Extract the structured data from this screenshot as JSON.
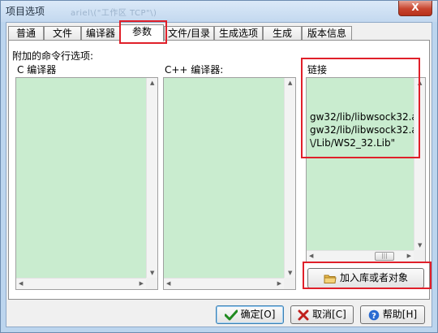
{
  "window": {
    "title": "项目选项",
    "title_ghost_text": "ariel\\(\"工作区 TCP\"\\)",
    "close_label": "X"
  },
  "tabs": [
    {
      "label": "普通",
      "active": false
    },
    {
      "label": "文件",
      "active": false
    },
    {
      "label": "编译器",
      "active": false
    },
    {
      "label": "参数",
      "active": true
    },
    {
      "label": "文件/目录",
      "active": false
    },
    {
      "label": "生成选项",
      "active": false
    },
    {
      "label": "生成",
      "active": false
    },
    {
      "label": "版本信息",
      "active": false
    }
  ],
  "panel": {
    "caption": "附加的命令行选项:",
    "c_compiler_label": "C 编译器",
    "cpp_compiler_label": "C++ 编译器:",
    "linker_label": "链接",
    "linker_lines": [
      "gw32/lib/libwsock32.a",
      "gw32/lib/libwsock32.a",
      "\\/Lib/WS2_32.Lib\""
    ],
    "add_lib_button": "加入库或者对象",
    "memo_color": "#c9eccf"
  },
  "buttons": {
    "ok": "确定[O]",
    "cancel": "取消[C]",
    "help": "帮助[H]"
  },
  "icons": {
    "ok": "checkmark-icon",
    "cancel": "x-icon",
    "help": "help-icon",
    "add_lib": "folder-icon"
  },
  "accent": {
    "highlight_red": "#e0202a"
  }
}
